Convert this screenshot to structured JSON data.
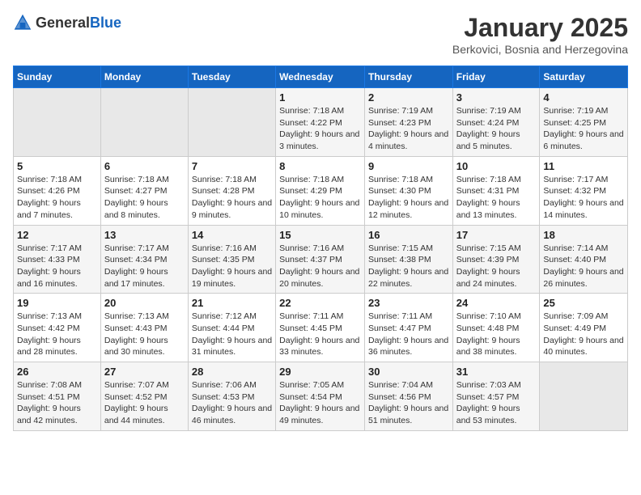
{
  "logo": {
    "general": "General",
    "blue": "Blue"
  },
  "title": "January 2025",
  "subtitle": "Berkovici, Bosnia and Herzegovina",
  "days_of_week": [
    "Sunday",
    "Monday",
    "Tuesday",
    "Wednesday",
    "Thursday",
    "Friday",
    "Saturday"
  ],
  "weeks": [
    [
      {
        "day": "",
        "info": ""
      },
      {
        "day": "",
        "info": ""
      },
      {
        "day": "",
        "info": ""
      },
      {
        "day": "1",
        "info": "Sunrise: 7:18 AM\nSunset: 4:22 PM\nDaylight: 9 hours and 3 minutes."
      },
      {
        "day": "2",
        "info": "Sunrise: 7:19 AM\nSunset: 4:23 PM\nDaylight: 9 hours and 4 minutes."
      },
      {
        "day": "3",
        "info": "Sunrise: 7:19 AM\nSunset: 4:24 PM\nDaylight: 9 hours and 5 minutes."
      },
      {
        "day": "4",
        "info": "Sunrise: 7:19 AM\nSunset: 4:25 PM\nDaylight: 9 hours and 6 minutes."
      }
    ],
    [
      {
        "day": "5",
        "info": "Sunrise: 7:18 AM\nSunset: 4:26 PM\nDaylight: 9 hours and 7 minutes."
      },
      {
        "day": "6",
        "info": "Sunrise: 7:18 AM\nSunset: 4:27 PM\nDaylight: 9 hours and 8 minutes."
      },
      {
        "day": "7",
        "info": "Sunrise: 7:18 AM\nSunset: 4:28 PM\nDaylight: 9 hours and 9 minutes."
      },
      {
        "day": "8",
        "info": "Sunrise: 7:18 AM\nSunset: 4:29 PM\nDaylight: 9 hours and 10 minutes."
      },
      {
        "day": "9",
        "info": "Sunrise: 7:18 AM\nSunset: 4:30 PM\nDaylight: 9 hours and 12 minutes."
      },
      {
        "day": "10",
        "info": "Sunrise: 7:18 AM\nSunset: 4:31 PM\nDaylight: 9 hours and 13 minutes."
      },
      {
        "day": "11",
        "info": "Sunrise: 7:17 AM\nSunset: 4:32 PM\nDaylight: 9 hours and 14 minutes."
      }
    ],
    [
      {
        "day": "12",
        "info": "Sunrise: 7:17 AM\nSunset: 4:33 PM\nDaylight: 9 hours and 16 minutes."
      },
      {
        "day": "13",
        "info": "Sunrise: 7:17 AM\nSunset: 4:34 PM\nDaylight: 9 hours and 17 minutes."
      },
      {
        "day": "14",
        "info": "Sunrise: 7:16 AM\nSunset: 4:35 PM\nDaylight: 9 hours and 19 minutes."
      },
      {
        "day": "15",
        "info": "Sunrise: 7:16 AM\nSunset: 4:37 PM\nDaylight: 9 hours and 20 minutes."
      },
      {
        "day": "16",
        "info": "Sunrise: 7:15 AM\nSunset: 4:38 PM\nDaylight: 9 hours and 22 minutes."
      },
      {
        "day": "17",
        "info": "Sunrise: 7:15 AM\nSunset: 4:39 PM\nDaylight: 9 hours and 24 minutes."
      },
      {
        "day": "18",
        "info": "Sunrise: 7:14 AM\nSunset: 4:40 PM\nDaylight: 9 hours and 26 minutes."
      }
    ],
    [
      {
        "day": "19",
        "info": "Sunrise: 7:13 AM\nSunset: 4:42 PM\nDaylight: 9 hours and 28 minutes."
      },
      {
        "day": "20",
        "info": "Sunrise: 7:13 AM\nSunset: 4:43 PM\nDaylight: 9 hours and 30 minutes."
      },
      {
        "day": "21",
        "info": "Sunrise: 7:12 AM\nSunset: 4:44 PM\nDaylight: 9 hours and 31 minutes."
      },
      {
        "day": "22",
        "info": "Sunrise: 7:11 AM\nSunset: 4:45 PM\nDaylight: 9 hours and 33 minutes."
      },
      {
        "day": "23",
        "info": "Sunrise: 7:11 AM\nSunset: 4:47 PM\nDaylight: 9 hours and 36 minutes."
      },
      {
        "day": "24",
        "info": "Sunrise: 7:10 AM\nSunset: 4:48 PM\nDaylight: 9 hours and 38 minutes."
      },
      {
        "day": "25",
        "info": "Sunrise: 7:09 AM\nSunset: 4:49 PM\nDaylight: 9 hours and 40 minutes."
      }
    ],
    [
      {
        "day": "26",
        "info": "Sunrise: 7:08 AM\nSunset: 4:51 PM\nDaylight: 9 hours and 42 minutes."
      },
      {
        "day": "27",
        "info": "Sunrise: 7:07 AM\nSunset: 4:52 PM\nDaylight: 9 hours and 44 minutes."
      },
      {
        "day": "28",
        "info": "Sunrise: 7:06 AM\nSunset: 4:53 PM\nDaylight: 9 hours and 46 minutes."
      },
      {
        "day": "29",
        "info": "Sunrise: 7:05 AM\nSunset: 4:54 PM\nDaylight: 9 hours and 49 minutes."
      },
      {
        "day": "30",
        "info": "Sunrise: 7:04 AM\nSunset: 4:56 PM\nDaylight: 9 hours and 51 minutes."
      },
      {
        "day": "31",
        "info": "Sunrise: 7:03 AM\nSunset: 4:57 PM\nDaylight: 9 hours and 53 minutes."
      },
      {
        "day": "",
        "info": ""
      }
    ]
  ]
}
